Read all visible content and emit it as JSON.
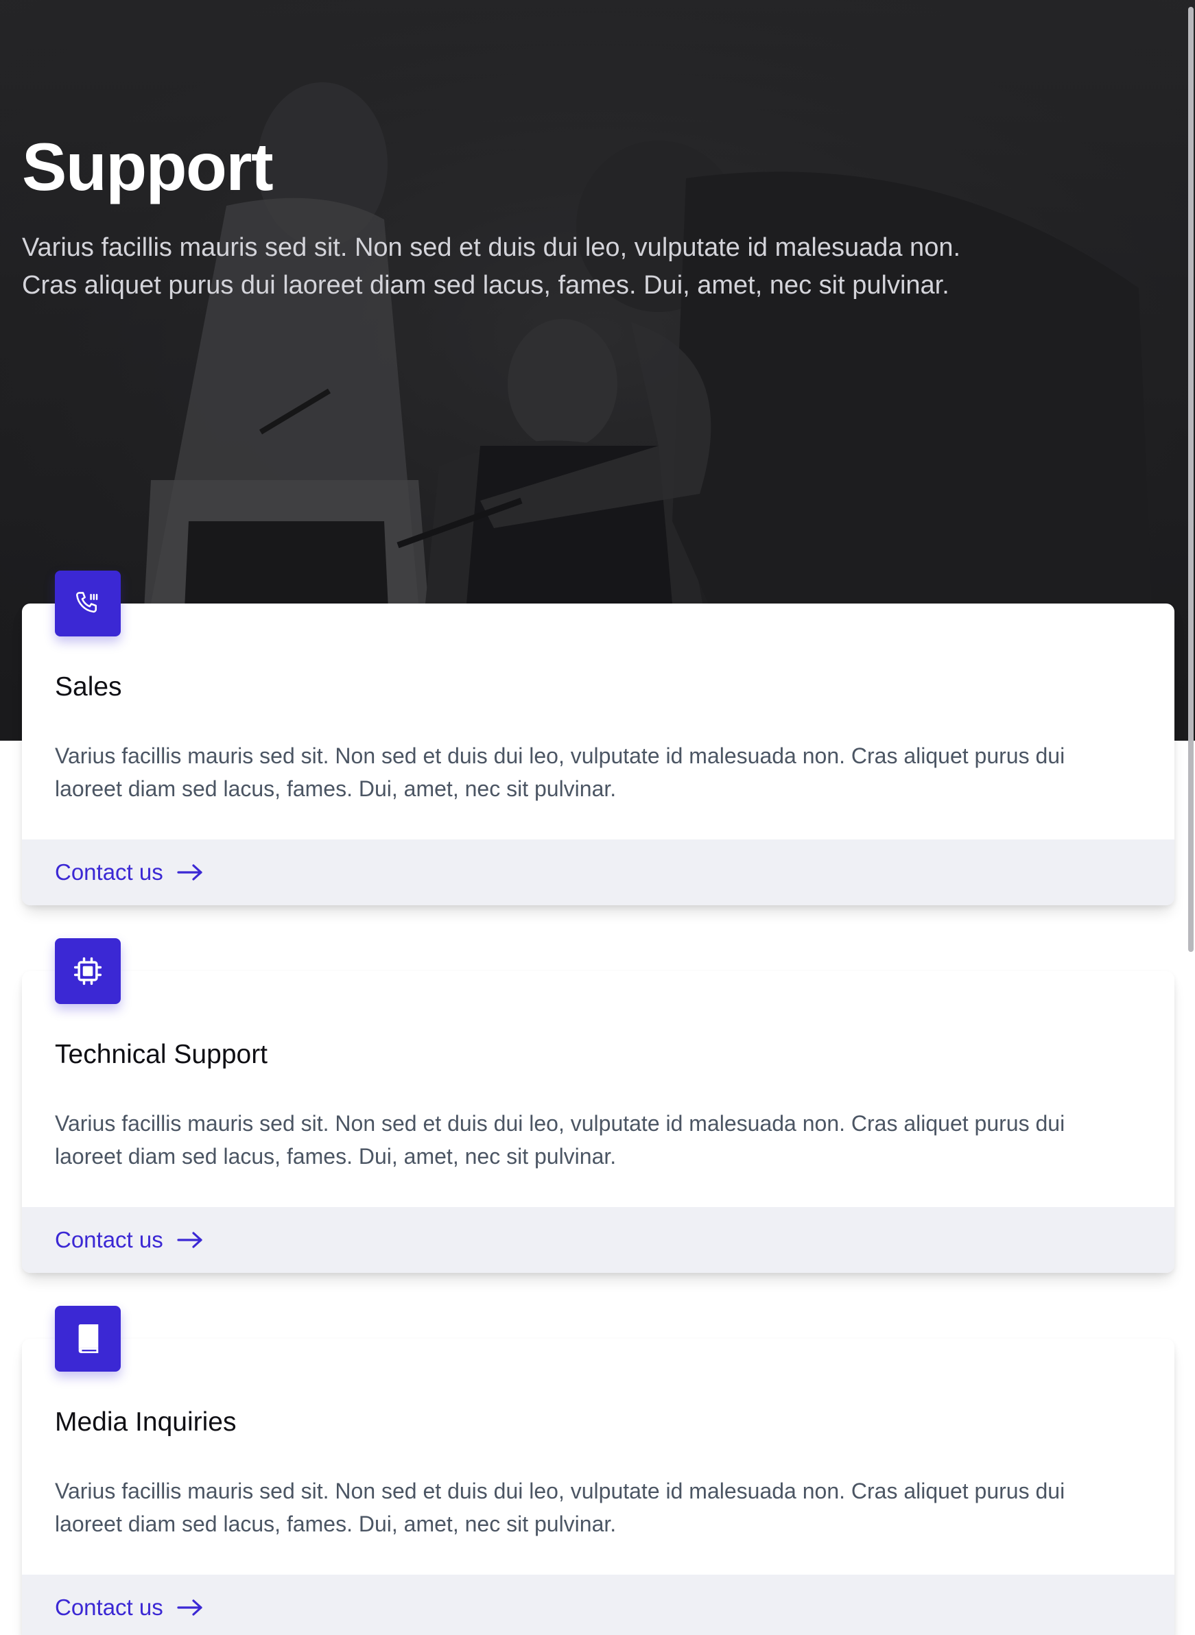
{
  "hero": {
    "title": "Support",
    "description_line1": "Varius facillis mauris sed sit. Non sed et duis dui leo, vulputate id malesuada non.",
    "description_line2": "Cras aliquet purus dui laoreet diam sed lacus, fames. Dui, amet, nec sit pulvinar."
  },
  "cards": [
    {
      "title": "Sales",
      "icon": "phone-icon",
      "body": "Varius facillis mauris sed sit. Non sed et duis dui leo, vulputate id malesuada non. Cras aliquet purus dui laoreet diam sed lacus, fames. Dui, amet, nec sit pulvinar.",
      "link_label": "Contact us"
    },
    {
      "title": "Technical Support",
      "icon": "chip-icon",
      "body": "Varius facillis mauris sed sit. Non sed et duis dui leo, vulputate id malesuada non. Cras aliquet purus dui laoreet diam sed lacus, fames. Dui, amet, nec sit pulvinar.",
      "link_label": "Contact us"
    },
    {
      "title": "Media Inquiries",
      "icon": "book-icon",
      "body": "Varius facillis mauris sed sit. Non sed et duis dui leo, vulputate id malesuada non. Cras aliquet purus dui laoreet diam sed lacus, fames. Dui, amet, nec sit pulvinar.",
      "link_label": "Contact us"
    }
  ],
  "colors": {
    "accent": "#3b28d4",
    "footer_bg": "#eff0f5",
    "hero_overlay": "#2a2a2c",
    "body_text": "#4b5563"
  }
}
